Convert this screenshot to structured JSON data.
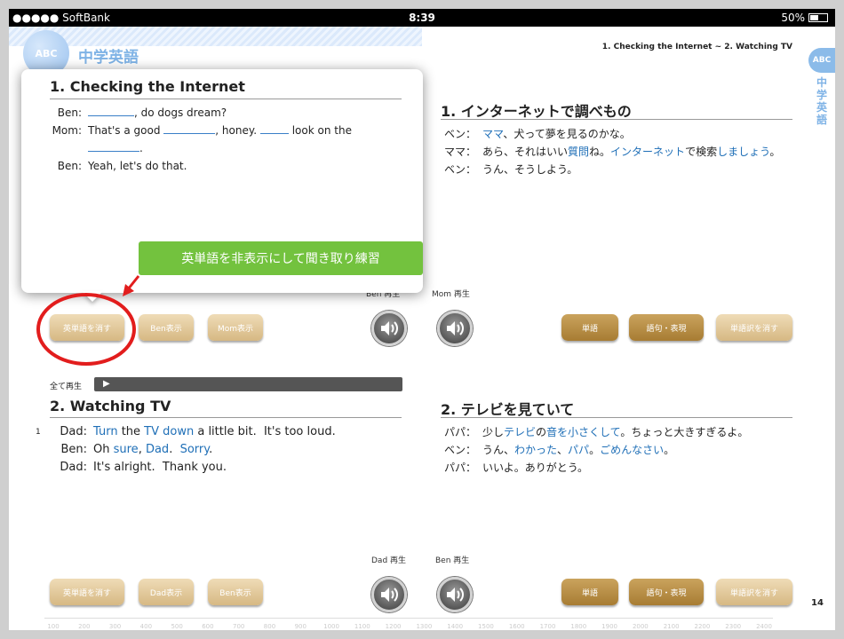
{
  "status_bar": {
    "carrier": "●●●●● SoftBank",
    "time": "8:39",
    "battery": "50%",
    "battery_fraction": 0.5
  },
  "header": {
    "badge": "ABC",
    "book_title": "中学英語",
    "range": "1. Checking the Internet ~ 2. Watching TV",
    "side_badge": "ABC",
    "side_title": "中学英語"
  },
  "popup": {
    "title": "1. Checking the Internet",
    "lines": [
      {
        "speaker": "Ben:",
        "text_before": "",
        "text_after": ", do dogs dream?"
      },
      {
        "speaker": "Mom:",
        "text_before": "That's a good",
        "text_mid": ", honey.",
        "text_after": "look on the"
      },
      {
        "speaker": "",
        "text_after": "."
      },
      {
        "speaker": "Ben:",
        "text": "Yeah, let's do that."
      }
    ],
    "callout": "英単語を非表示にして聞き取り練習"
  },
  "section1_ja": {
    "title": "1. インターネットで調べもの",
    "lines": [
      {
        "speaker": "ベン：",
        "parts": [
          {
            "t": "ママ",
            "hl": true
          },
          {
            "t": "、犬って夢を見るのかな。",
            "hl": false
          }
        ]
      },
      {
        "speaker": "ママ：",
        "parts": [
          {
            "t": "あら、それはいい",
            "hl": false
          },
          {
            "t": "質問",
            "hl": true
          },
          {
            "t": "ね。",
            "hl": false
          },
          {
            "t": "インターネット",
            "hl": true
          },
          {
            "t": "で検索",
            "hl": false
          },
          {
            "t": "しましょう",
            "hl": true
          },
          {
            "t": "。",
            "hl": false
          }
        ]
      },
      {
        "speaker": "ベン：",
        "parts": [
          {
            "t": "うん、そうしよう。",
            "hl": false
          }
        ]
      }
    ]
  },
  "controls1": {
    "hide_words": "英単語を消す",
    "show_a": "Ben表示",
    "show_b": "Mom表示",
    "speaker_a": "Ben 再生",
    "speaker_b": "Mom 再生",
    "words": "単語",
    "phrases": "語句・表現",
    "hide_translation": "単語訳を消す"
  },
  "play_all": {
    "label": "全て再生",
    "icon": "▶"
  },
  "section2": {
    "number": "1",
    "title": "2. Watching TV",
    "lines": [
      {
        "speaker": "Dad:",
        "parts": [
          {
            "t": "Turn",
            "hl": true
          },
          {
            "t": " the ",
            "hl": false
          },
          {
            "t": "TV down",
            "hl": true
          },
          {
            "t": " a little bit.  It's too loud.",
            "hl": false
          }
        ]
      },
      {
        "speaker": "Ben:",
        "parts": [
          {
            "t": "Oh ",
            "hl": false
          },
          {
            "t": "sure",
            "hl": true
          },
          {
            "t": ", ",
            "hl": false
          },
          {
            "t": "Dad",
            "hl": true
          },
          {
            "t": ".  ",
            "hl": false
          },
          {
            "t": "Sorry",
            "hl": true
          },
          {
            "t": ".",
            "hl": false
          }
        ]
      },
      {
        "speaker": "Dad:",
        "parts": [
          {
            "t": "It's alright.  Thank you.",
            "hl": false
          }
        ]
      }
    ]
  },
  "section2_ja": {
    "title": "2. テレビを見ていて",
    "lines": [
      {
        "speaker": "パパ：",
        "parts": [
          {
            "t": "少し",
            "hl": false
          },
          {
            "t": "テレビ",
            "hl": true
          },
          {
            "t": "の",
            "hl": false
          },
          {
            "t": "音を小さくして",
            "hl": true
          },
          {
            "t": "。ちょっと大きすぎるよ。",
            "hl": false
          }
        ]
      },
      {
        "speaker": "ベン：",
        "parts": [
          {
            "t": "うん、",
            "hl": false
          },
          {
            "t": "わかった",
            "hl": true
          },
          {
            "t": "、",
            "hl": false
          },
          {
            "t": "パパ",
            "hl": true
          },
          {
            "t": "。",
            "hl": false
          },
          {
            "t": "ごめんなさい",
            "hl": true
          },
          {
            "t": "。",
            "hl": false
          }
        ]
      },
      {
        "speaker": "パパ：",
        "parts": [
          {
            "t": "いいよ。ありがとう。",
            "hl": false
          }
        ]
      }
    ]
  },
  "controls2": {
    "hide_words": "英単語を消す",
    "show_a": "Dad表示",
    "show_b": "Ben表示",
    "speaker_a": "Dad 再生",
    "speaker_b": "Ben 再生",
    "words": "単語",
    "phrases": "語句・表現",
    "hide_translation": "単語訳を消す"
  },
  "ruler": [
    "100",
    "200",
    "300",
    "400",
    "500",
    "600",
    "700",
    "800",
    "900",
    "1000",
    "1100",
    "1200",
    "1300",
    "1400",
    "1500",
    "1600",
    "1700",
    "1800",
    "1900",
    "2000",
    "2100",
    "2200",
    "2300",
    "2400"
  ],
  "page_number": "14",
  "colors": {
    "highlight": "#1f6fb7",
    "callout": "#73c23e",
    "annotation": "#e21d1d",
    "button_gold": "#b98d42"
  }
}
